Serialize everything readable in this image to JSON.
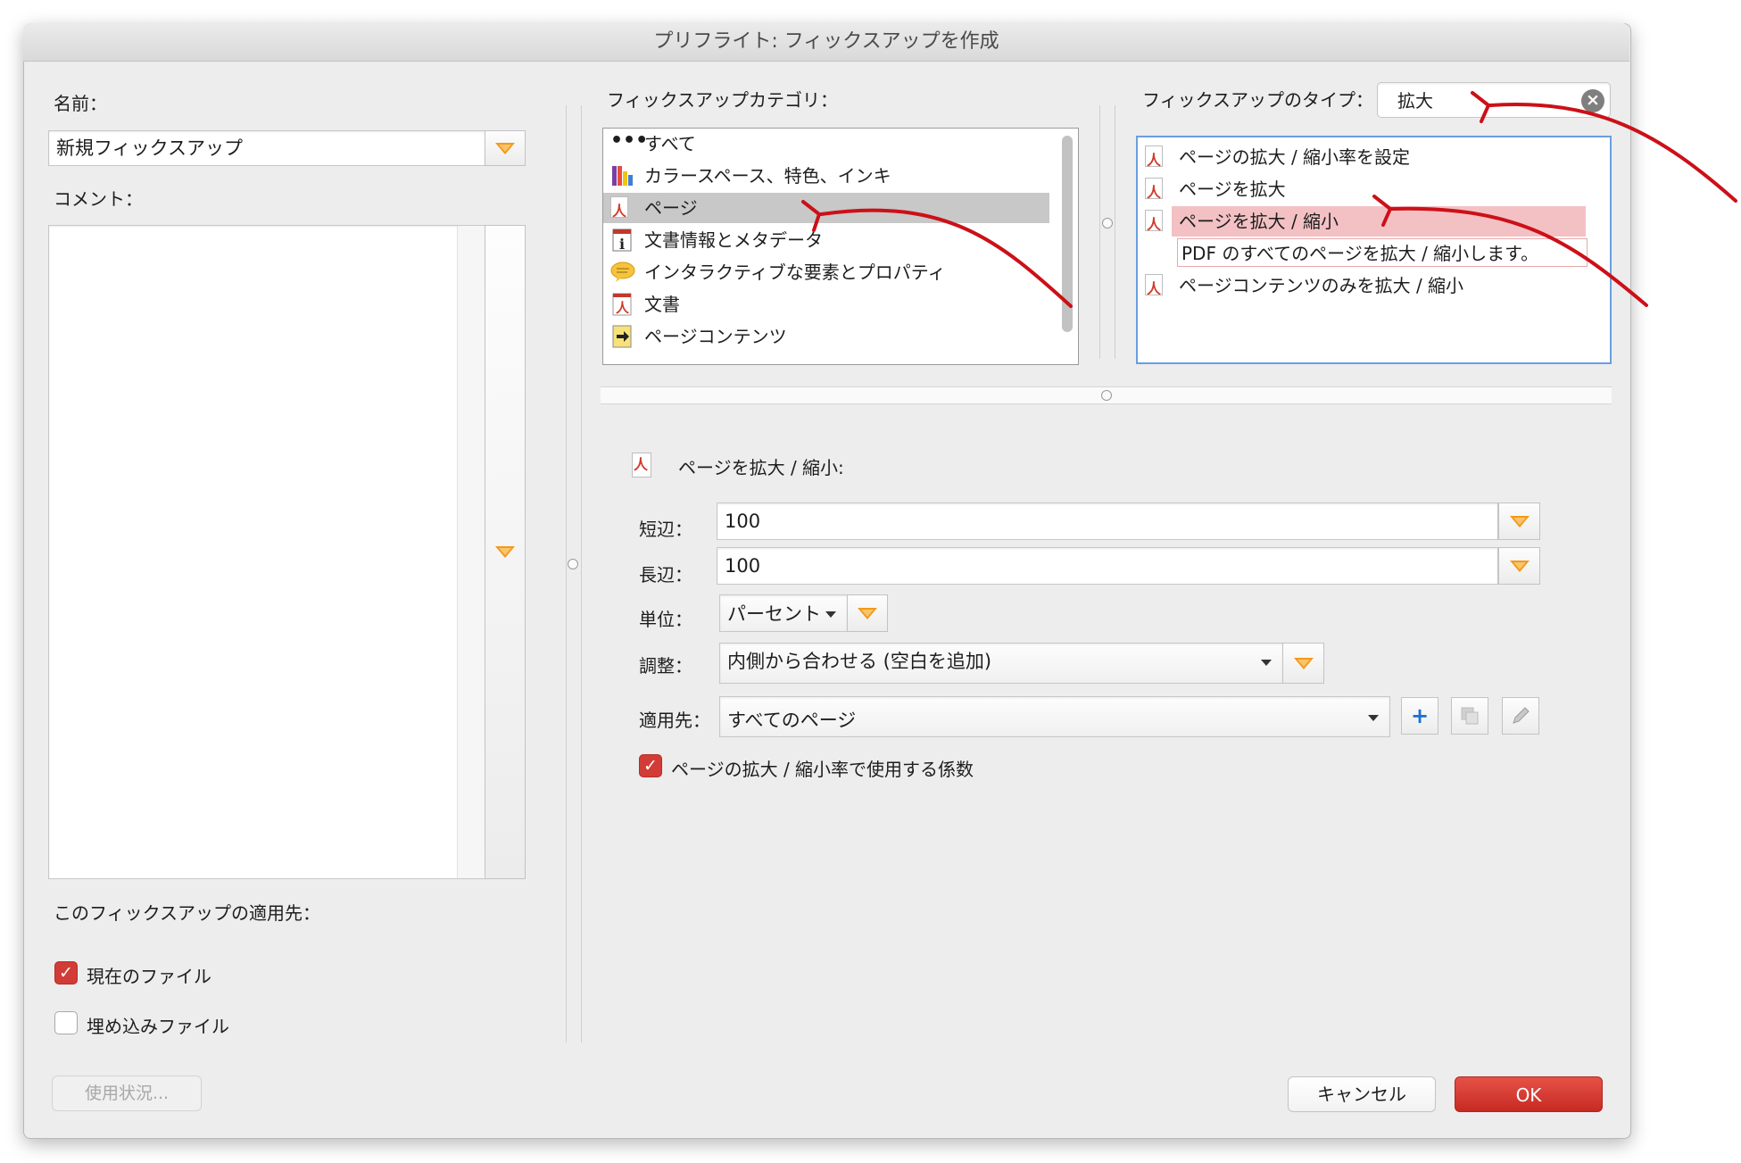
{
  "window": {
    "title": "プリフライト: フィックスアップを作成"
  },
  "left": {
    "name_label": "名前：",
    "name_value": "新規フィックスアップ",
    "comment_label": "コメント：",
    "apply_to_label": "このフィックスアップの適用先：",
    "checkboxes": [
      {
        "label": "現在のファイル",
        "checked": true
      },
      {
        "label": "埋め込みファイル",
        "checked": false
      }
    ],
    "usage_button": "使用状況..."
  },
  "category": {
    "label": "フィックスアップカテゴリ：",
    "items": [
      {
        "label": "すべて",
        "icon": "dots-icon"
      },
      {
        "label": "カラースペース、特色、インキ",
        "icon": "color-swatch-icon"
      },
      {
        "label": "ページ",
        "icon": "pdf-page-icon",
        "selected": true
      },
      {
        "label": "文書情報とメタデータ",
        "icon": "info-icon"
      },
      {
        "label": "インタラクティブな要素とプロパティ",
        "icon": "comment-bubble-icon"
      },
      {
        "label": "文書",
        "icon": "pdf-document-icon"
      },
      {
        "label": "ページコンテンツ",
        "icon": "page-content-icon"
      }
    ]
  },
  "type": {
    "label": "フィックスアップのタイプ：",
    "search_value": "拡大",
    "items": [
      {
        "label": "ページの拡大 / 縮小率を設定"
      },
      {
        "label": "ページを拡大"
      },
      {
        "label": "ページを拡大 / 縮小",
        "selected": true
      },
      {
        "label": "ページコンテンツのみを拡大 / 縮小"
      }
    ],
    "tooltip": "PDF のすべてのページを拡大 / 縮小します。"
  },
  "detail": {
    "header": "ページを拡大 / 縮小:",
    "short_edge_label": "短辺：",
    "short_edge_value": "100",
    "long_edge_label": "長辺：",
    "long_edge_value": "100",
    "unit_label": "単位：",
    "unit_value": "パーセント",
    "adjust_label": "調整：",
    "adjust_value": "内側から合わせる (空白を追加)",
    "apply_label": "適用先：",
    "apply_value": "すべてのページ",
    "factor_checkbox_label": "ページの拡大 / 縮小率で使用する係数",
    "factor_checked": true
  },
  "footer": {
    "cancel": "キャンセル",
    "ok": "OK"
  },
  "colors": {
    "accent": "#f29a1a",
    "checkbox_red": "#d23c36",
    "ok_red": "#d9342b",
    "annotation_red": "#cc1018",
    "selection_pink": "#f3c1c4"
  }
}
